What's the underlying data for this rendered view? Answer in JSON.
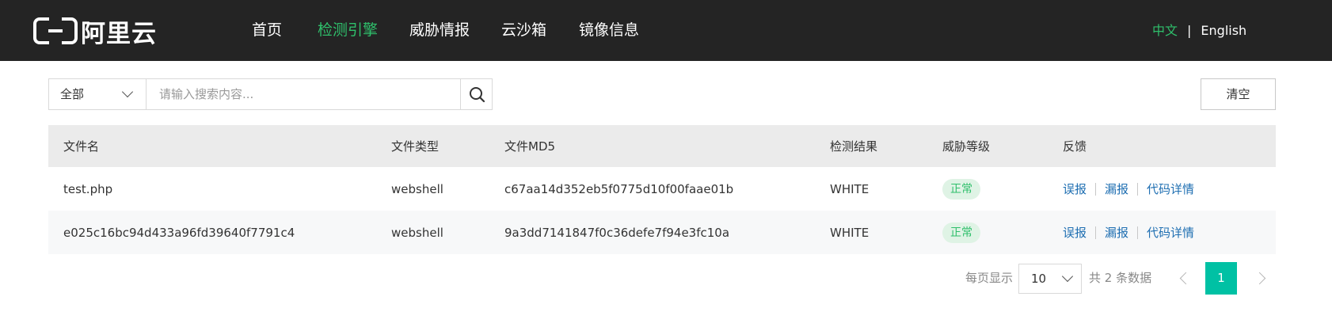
{
  "header": {
    "logo_text": "阿里云",
    "nav": [
      {
        "label": "首页",
        "active": false
      },
      {
        "label": "检测引擎",
        "active": true
      },
      {
        "label": "威胁情报",
        "active": false
      },
      {
        "label": "云沙箱",
        "active": false
      },
      {
        "label": "镜像信息",
        "active": false
      }
    ],
    "lang": {
      "zh": "中文",
      "separator": "|",
      "en": "English"
    }
  },
  "search": {
    "category_value": "全部",
    "placeholder": "请输入搜索内容...",
    "search_icon": "search-icon",
    "clear_label": "清空"
  },
  "table": {
    "headers": [
      "文件名",
      "文件类型",
      "文件MD5",
      "检测结果",
      "威胁等级",
      "反馈"
    ],
    "rows": [
      {
        "name": "test.php",
        "type": "webshell",
        "md5": "c67aa14d352eb5f0775d10f00faae01b",
        "result": "WHITE",
        "level": "正常",
        "actions": [
          "误报",
          "漏报",
          "代码详情"
        ]
      },
      {
        "name": "e025c16bc94d433a96fd39640f7791c4",
        "type": "webshell",
        "md5": "9a3dd7141847f0c36defe7f94e3fc10a",
        "result": "WHITE",
        "level": "正常",
        "actions": [
          "误报",
          "漏报",
          "代码详情"
        ]
      }
    ]
  },
  "pagination": {
    "per_page_label": "每页显示",
    "per_page_value": "10",
    "total_label": "共 2 条数据",
    "current_page": "1"
  },
  "colors": {
    "topbar": "#242424",
    "active_nav": "#2fbf6b",
    "link": "#1f6fb2",
    "page_active": "#00c1a4"
  }
}
